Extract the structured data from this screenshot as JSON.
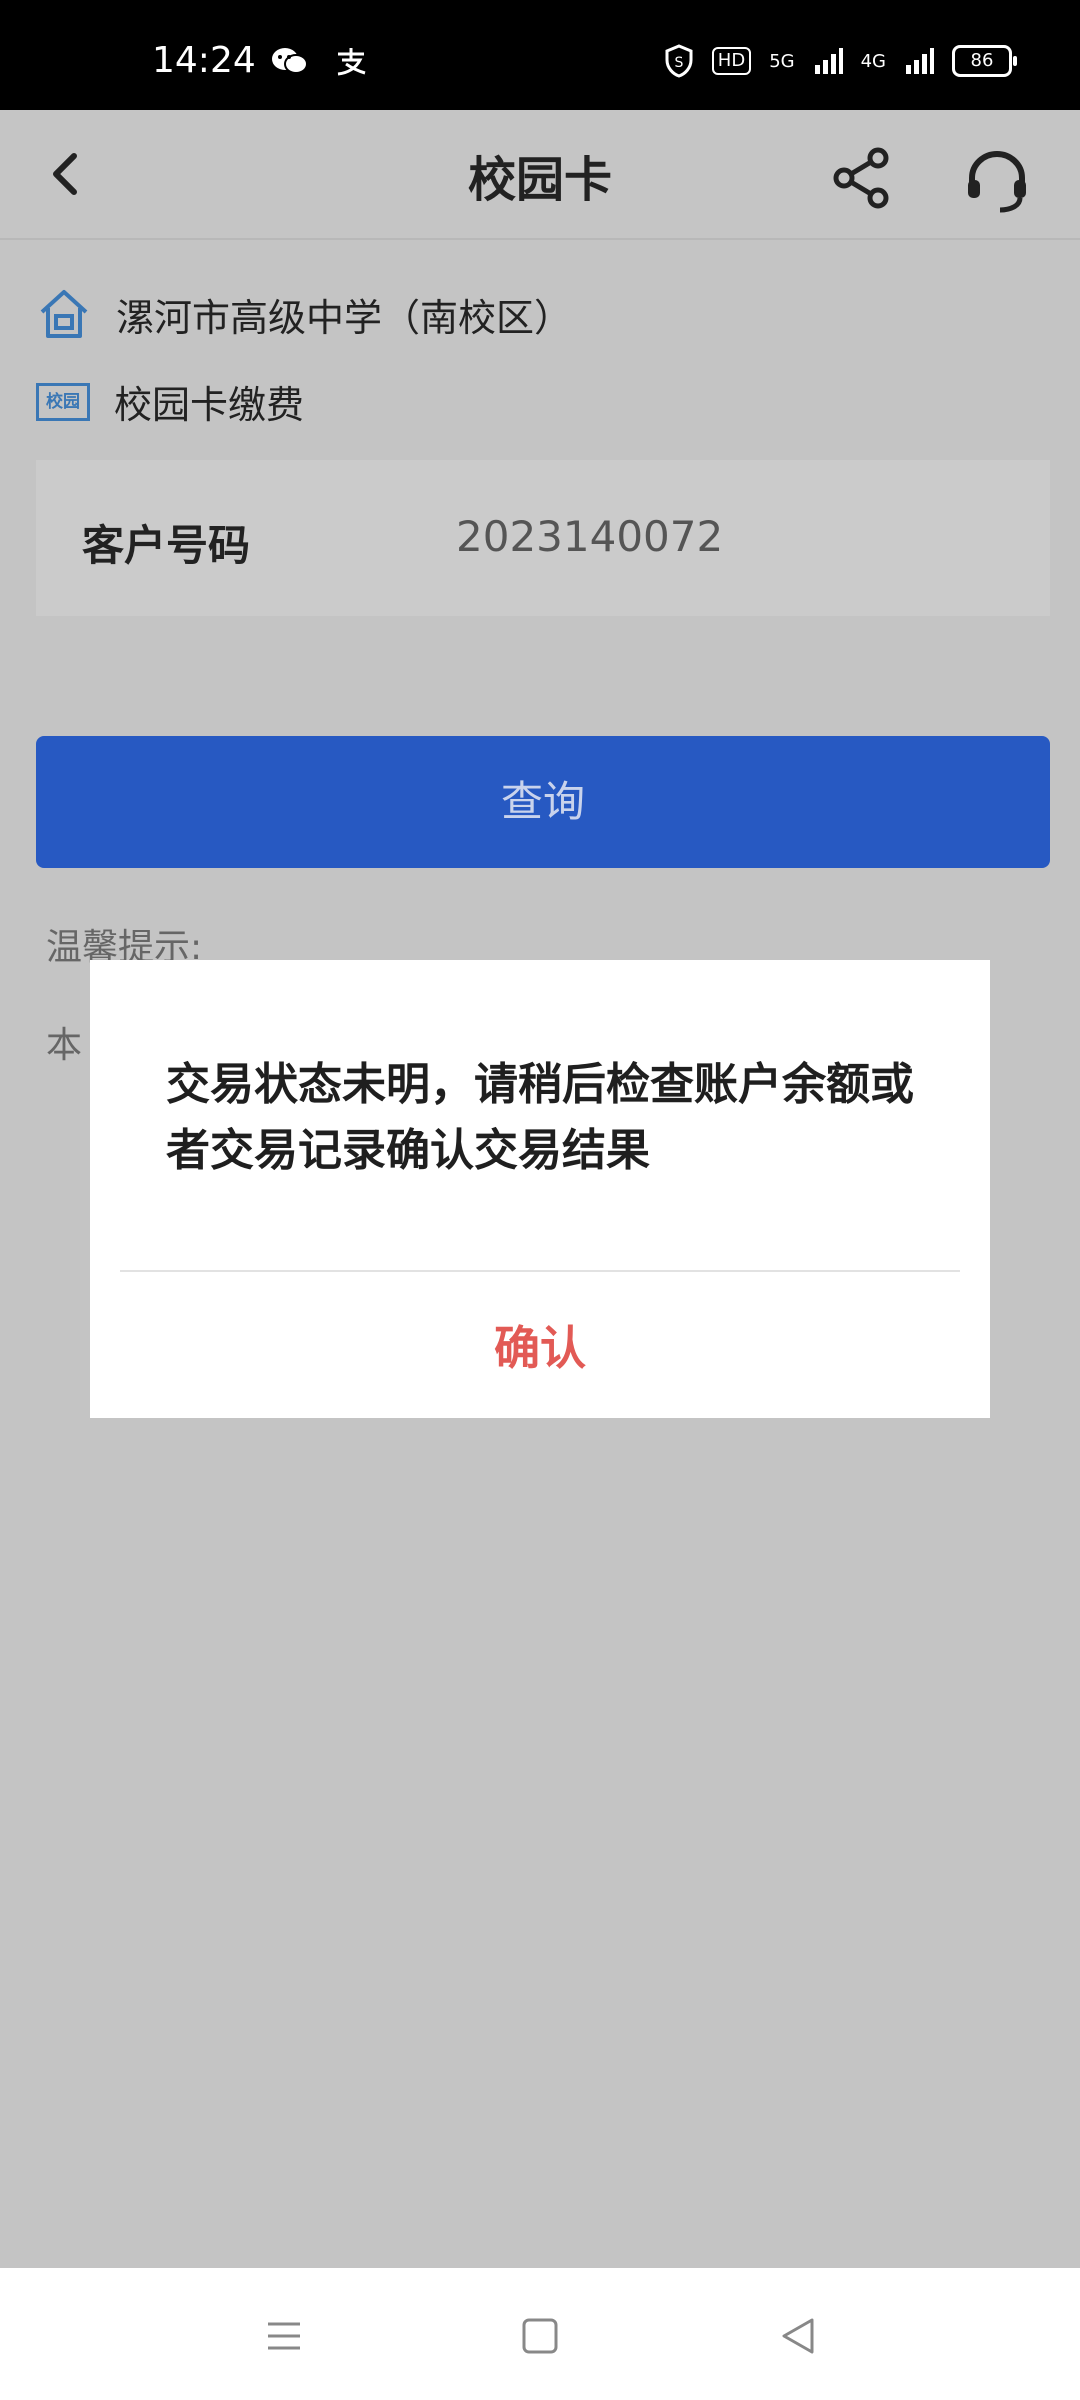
{
  "status_bar": {
    "time": "14:24",
    "left_icons": [
      "wechat-icon",
      "alipay-icon"
    ],
    "right_badges": [
      "HD",
      "5G",
      "4G"
    ],
    "battery": "86"
  },
  "header": {
    "title": "校园卡",
    "icons": [
      "back-arrow-icon",
      "share-icon",
      "headset-icon"
    ]
  },
  "info": {
    "school": "漯河市高级中学（南校区）",
    "pay_item": "校园卡缴费",
    "campus_badge": "校园"
  },
  "form": {
    "customer_label": "客户号码",
    "customer_value": "2023140072"
  },
  "actions": {
    "query_label": "查询"
  },
  "tips": {
    "title": "温馨提示:",
    "body_partial": "本"
  },
  "dialog": {
    "message": "交易状态未明，请稍后检查账户余额或者交易记录确认交易结果",
    "confirm_label": "确认"
  },
  "colors": {
    "primary_blue": "#2759c2",
    "confirm_red": "#e25a55",
    "overlay_gray": "#c4c4c4"
  }
}
